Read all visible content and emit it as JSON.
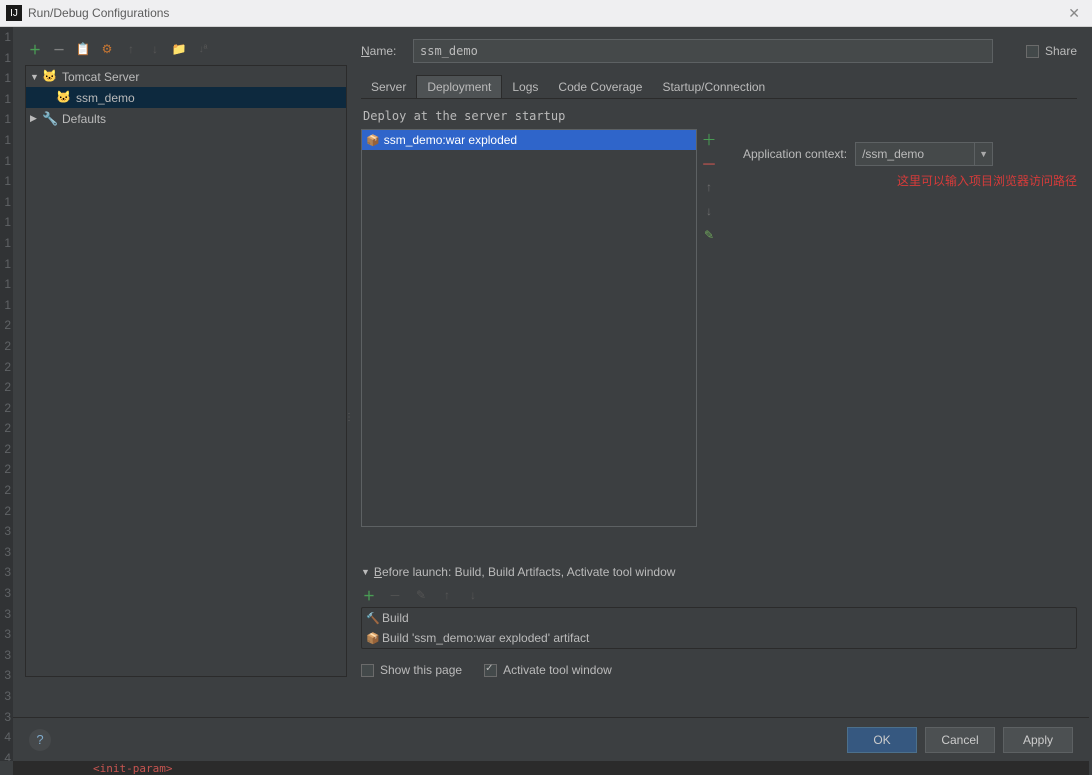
{
  "window": {
    "title": "Run/Debug Configurations"
  },
  "gutter": [
    "1",
    "1",
    "1",
    "1",
    "1",
    "1",
    "1",
    "1",
    "1",
    "1",
    "1",
    "1",
    "1",
    "1",
    "2",
    "2",
    "2",
    "2",
    "2",
    "2",
    "2",
    "2",
    "2",
    "2",
    "3",
    "3",
    "3",
    "3",
    "3",
    "3",
    "3",
    "3",
    "3",
    "3",
    "4",
    "4"
  ],
  "tree": {
    "root": "Tomcat Server",
    "child": "ssm_demo",
    "defaults": "Defaults"
  },
  "name": {
    "label_pre": "N",
    "label_rest": "ame:",
    "value": "ssm_demo"
  },
  "share": {
    "ul": "S",
    "rest": "hare"
  },
  "tabs": [
    "Server",
    "Deployment",
    "Logs",
    "Code Coverage",
    "Startup/Connection"
  ],
  "active_tab": 1,
  "deploy": {
    "header": "Deploy at the server startup",
    "artifact": "ssm_demo:war exploded",
    "context_label": "Application context:",
    "context_value": "/ssm_demo",
    "hint": "这里可以输入项目浏览器访问路径"
  },
  "before": {
    "header_ul": "B",
    "header_rest": "efore launch: Build, Build Artifacts, Activate tool window",
    "items": [
      {
        "icon": "🔨",
        "label": "Build",
        "iconcolor": "#6fa65b"
      },
      {
        "icon": "📦",
        "label": "Build 'ssm_demo:war exploded' artifact",
        "iconcolor": "#c77434"
      }
    ],
    "show": "Show this page",
    "activate": "Activate tool window"
  },
  "buttons": {
    "ok": "OK",
    "cancel": "Cancel",
    "apply": "Apply"
  },
  "strip": "<init-param>"
}
